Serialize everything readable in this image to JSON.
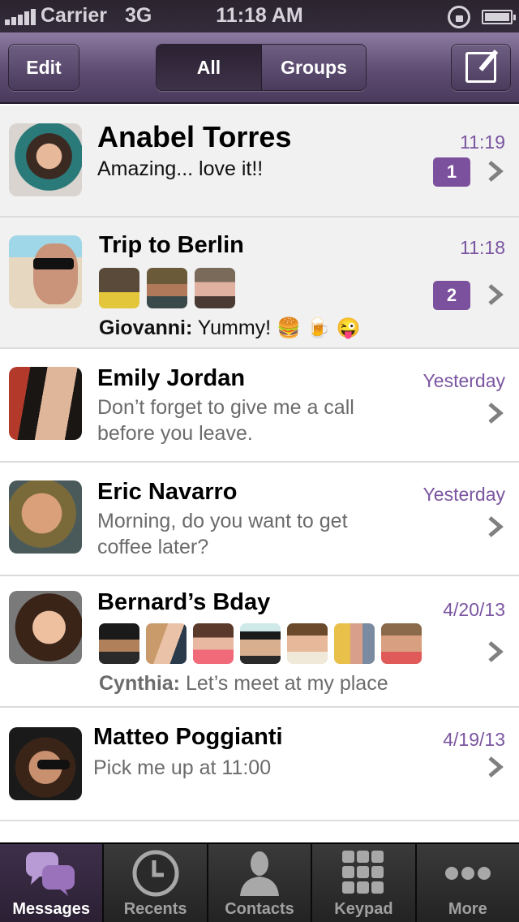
{
  "status_bar": {
    "carrier": "Carrier",
    "network": "3G",
    "time": "11:18 AM",
    "signal_bars": 5,
    "icons": [
      "signal-icon",
      "rotation-lock-icon",
      "battery-icon"
    ]
  },
  "nav": {
    "edit_label": "Edit",
    "segments": [
      {
        "label": "All",
        "selected": true
      },
      {
        "label": "Groups",
        "selected": false
      }
    ],
    "compose_icon": "compose-icon"
  },
  "colors": {
    "accent": "#7b509c",
    "time_text": "#7b55a0",
    "nav_bar": "#5e4c72",
    "unread_bg": "#f1f1f1"
  },
  "conversations": [
    {
      "name": "Anabel Torres",
      "time": "11:19",
      "message": "Amazing... love it!!",
      "unread": 1,
      "type": "contact"
    },
    {
      "name": "Trip to Berlin",
      "time": "11:18",
      "sender": "Giovanni:",
      "message": "Yummy!",
      "emojis": [
        "🍔",
        "🍺",
        "😜"
      ],
      "unread": 2,
      "type": "group",
      "participants": 3
    },
    {
      "name": "Emily Jordan",
      "time": "Yesterday",
      "message_line1": "Don’t forget to give me a call",
      "message_line2": "before you leave.",
      "type": "contact"
    },
    {
      "name": "Eric Navarro",
      "time": "Yesterday",
      "message_line1": "Morning, do you want to get",
      "message_line2": "coffee later?",
      "type": "contact"
    },
    {
      "name": "Bernard’s Bday",
      "time": "4/20/13",
      "sender": "Cynthia:",
      "message": "Let’s meet at my place",
      "type": "group",
      "participants": 7
    },
    {
      "name": "Matteo Poggianti",
      "time": "4/19/13",
      "message": "Pick me up at 11:00",
      "type": "contact"
    }
  ],
  "tabs": [
    {
      "label": "Messages",
      "icon": "messages-icon",
      "active": true
    },
    {
      "label": "Recents",
      "icon": "clock-icon",
      "active": false
    },
    {
      "label": "Contacts",
      "icon": "person-icon",
      "active": false
    },
    {
      "label": "Keypad",
      "icon": "keypad-icon",
      "active": false
    },
    {
      "label": "More",
      "icon": "more-icon",
      "active": false
    }
  ]
}
